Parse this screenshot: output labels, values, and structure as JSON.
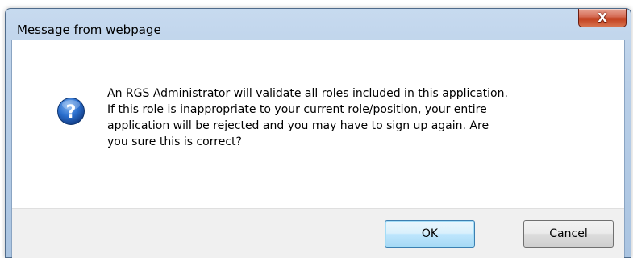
{
  "window": {
    "title": "Message from webpage",
    "close_glyph": "X"
  },
  "dialog": {
    "icon": "question-icon",
    "message_lines": [
      "An RGS Administrator will validate all roles included in this application.",
      "If this role is inappropriate to your current role/position, your entire",
      "application will be rejected and you may have to sign up again.  Are",
      "you sure this is correct?"
    ]
  },
  "buttons": {
    "ok_label": "OK",
    "cancel_label": "Cancel"
  },
  "colors": {
    "frame": "#b9cfe8",
    "close_button": "#c2401f",
    "icon_blue": "#1f5fb8",
    "default_button_border": "#3c7fb1",
    "footer": "#f0f0f0"
  }
}
